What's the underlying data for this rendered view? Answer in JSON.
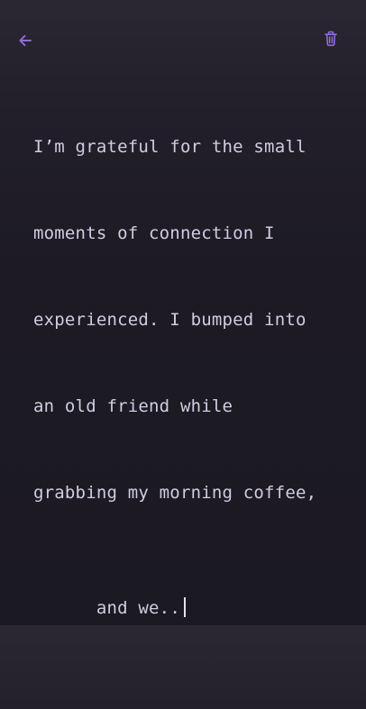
{
  "header": {
    "back_icon": "arrow-left-icon",
    "delete_icon": "trash-icon"
  },
  "entry": {
    "lines": [
      "I’m grateful for the small",
      "moments of connection I",
      "experienced. I bumped into",
      "an old friend while",
      "grabbing my morning coffee,",
      "and we.."
    ]
  },
  "colors": {
    "accent": "#8f6cd6",
    "text": "#d2cce2",
    "background_top": "#2a2632",
    "background_bottom": "#1b1921"
  }
}
